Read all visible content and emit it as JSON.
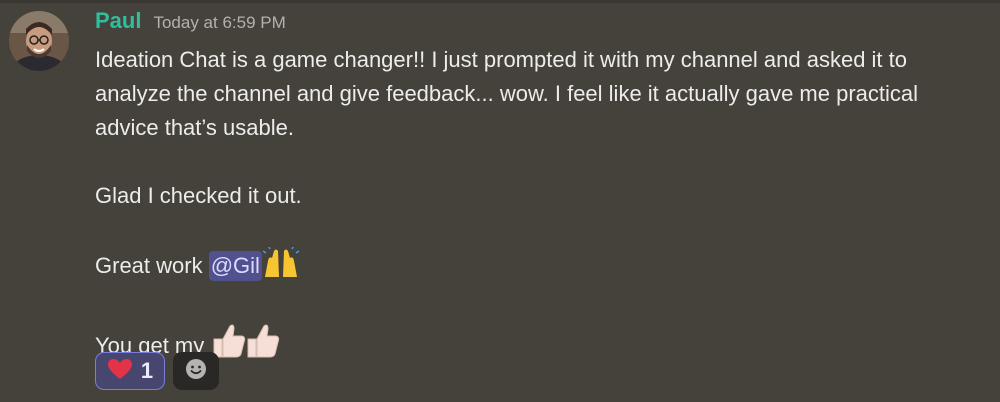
{
  "message": {
    "author": "Paul",
    "timestamp": "Today at 6:59 PM",
    "paragraphs": {
      "p1_line1": "Ideation Chat is a game changer!! I just prompted it with my channel and asked it to",
      "p1_line2": "analyze the channel and give feedback... wow. I feel like it actually gave me practical",
      "p1_line3": "advice that’s usable.",
      "p2": "Glad I checked it out.",
      "p3_prefix": "Great work ",
      "p3_mention": "@Gil",
      "p3_emoji": "raising-hands-emoji",
      "p4_prefix": "You get my ",
      "p4_emoji": "thumbs-up-emoji"
    }
  },
  "reactions": [
    {
      "emoji": "heart-icon",
      "count": "1",
      "active": true
    }
  ],
  "add_reaction": {
    "icon": "smiley-add-reaction-icon"
  },
  "colors": {
    "background": "#45413b",
    "username": "#2dbf9e",
    "mention_bg": "#52518f",
    "reaction_active_bg": "#47466e",
    "reaction_active_border": "#7a7ddc",
    "heart": "#e23446"
  }
}
